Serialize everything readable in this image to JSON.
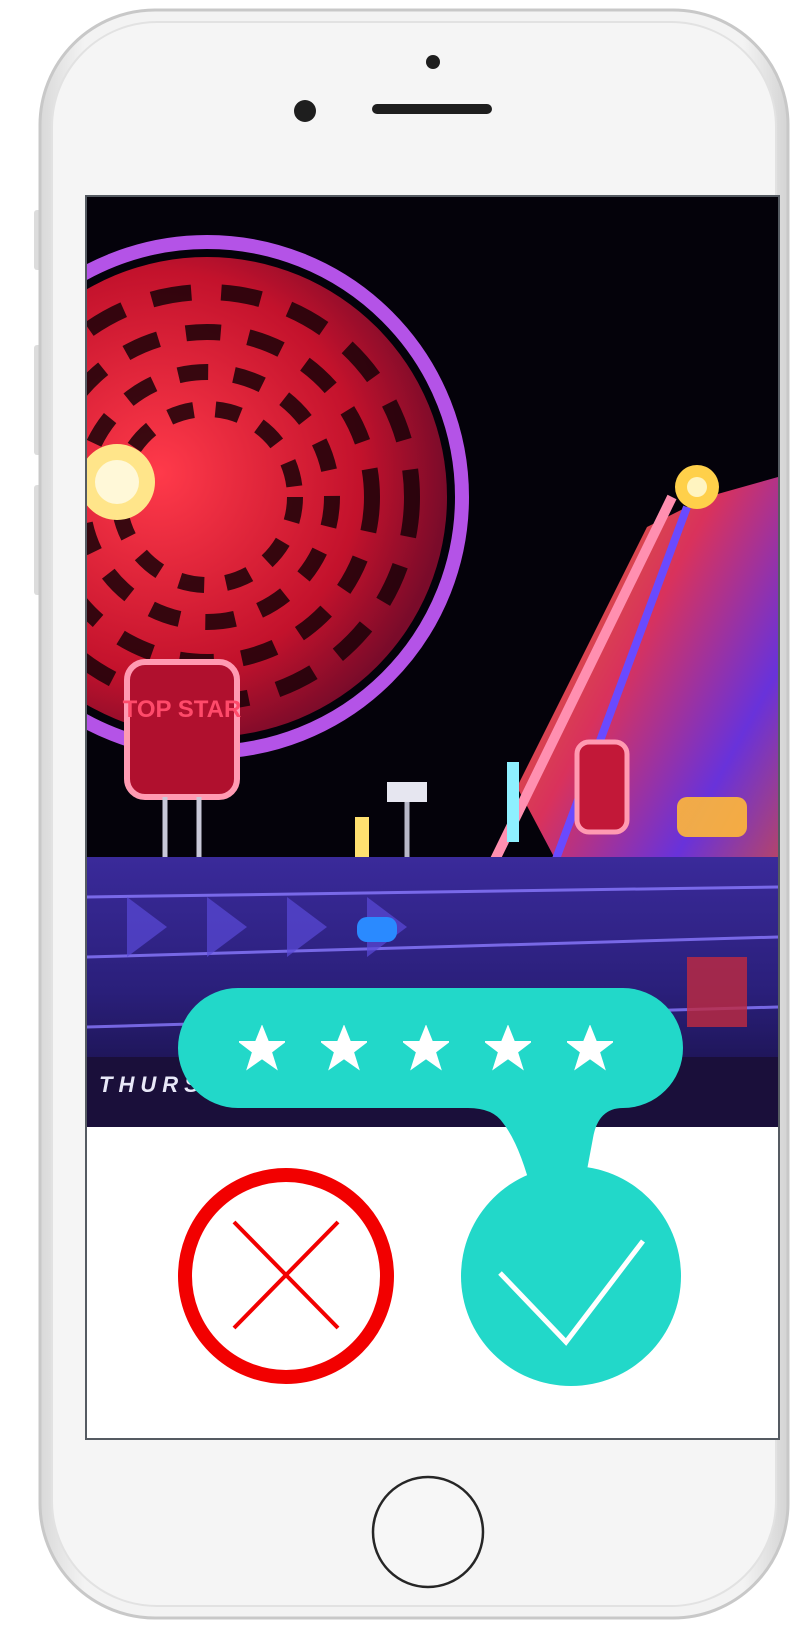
{
  "photo": {
    "sign_text": "TOP STAR",
    "banner_text": "THURSTO"
  },
  "rating": {
    "stars_total": 5,
    "stars_filled": 5,
    "bubble_color": "#22d8c9",
    "star_color": "#ffffff"
  },
  "actions": {
    "reject_color": "#f20000",
    "accept_color": "#22d8c9",
    "reject_icon": "x-icon",
    "accept_icon": "check-icon"
  }
}
